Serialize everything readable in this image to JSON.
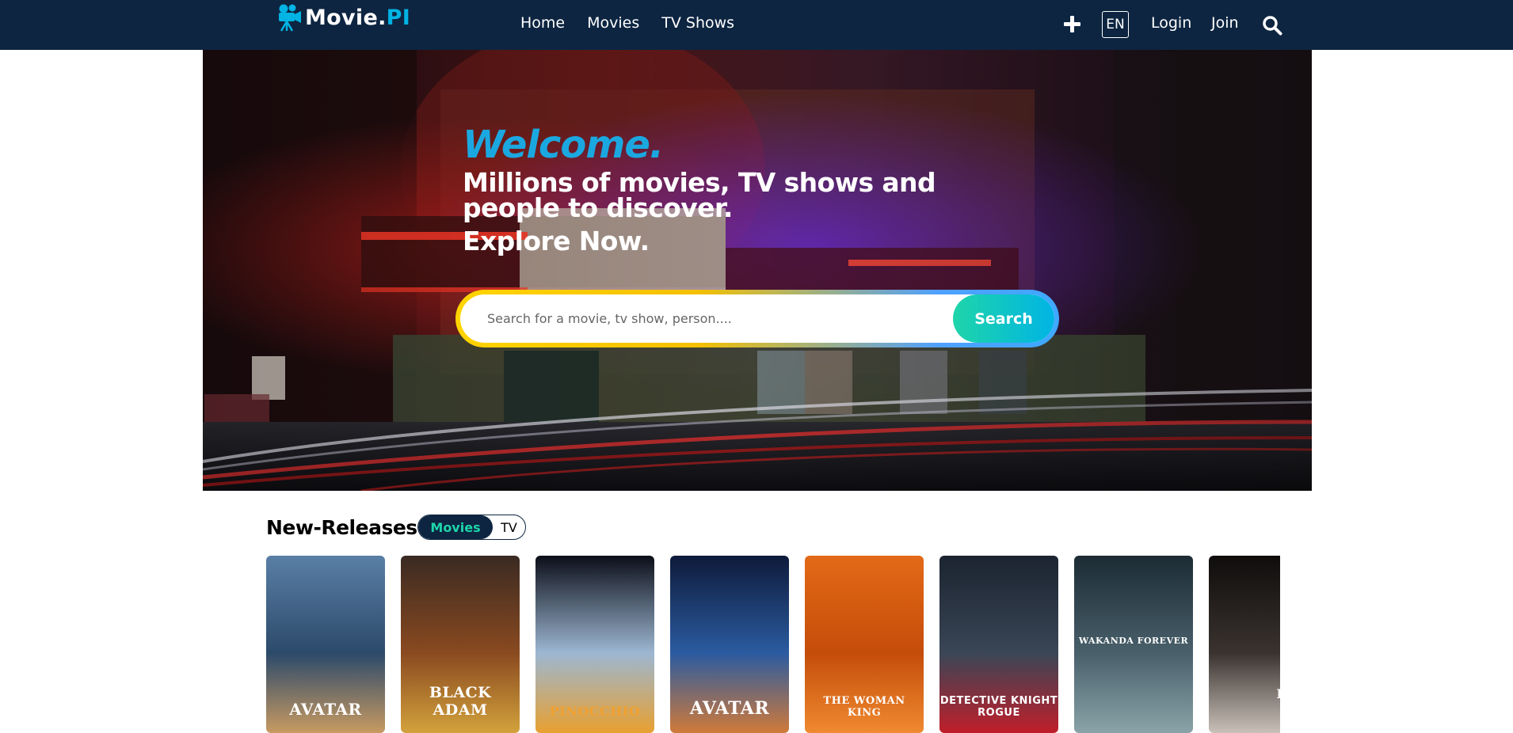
{
  "header": {
    "logo_main": "Movie.",
    "logo_accent": "PI",
    "nav": [
      "Home",
      "Movies",
      "TV Shows"
    ],
    "language": "EN",
    "login": "Login",
    "join": "Join"
  },
  "hero": {
    "welcome": "Welcome.",
    "tagline": "Millions of movies, TV shows and people to discover.",
    "explore": "Explore Now.",
    "search_placeholder": "Search for a movie, tv show, person....",
    "search_button": "Search"
  },
  "new_releases": {
    "title": "New-Releases",
    "toggle": {
      "active": "Movies",
      "inactive": "TV"
    },
    "posters": [
      {
        "title": "AVATAR",
        "colors": [
          "#5a7fa6",
          "#2c4a6a",
          "#c89a62"
        ]
      },
      {
        "title": "BLACK ADAM",
        "colors": [
          "#3a2a22",
          "#8a4a20",
          "#d3a23c"
        ]
      },
      {
        "title": "PINOCCHIO",
        "colors": [
          "#0b0e18",
          "#9db7d2",
          "#e8a030"
        ]
      },
      {
        "title": "AVATAR",
        "colors": [
          "#0e1a3a",
          "#2b5ba0",
          "#d07a3a"
        ]
      },
      {
        "title": "THE WOMAN KING",
        "colors": [
          "#e36a17",
          "#c44d0a",
          "#f08a30"
        ]
      },
      {
        "title": "DETECTIVE KNIGHT ROGUE",
        "colors": [
          "#1b2430",
          "#3a4656",
          "#c01e2a"
        ]
      },
      {
        "title": "WAKANDA FOREVER",
        "colors": [
          "#1c2b34",
          "#49606b",
          "#8aa3a8"
        ]
      },
      {
        "title": "PR DR",
        "colors": [
          "#0f0d0c",
          "#3a3330",
          "#c9c0b8"
        ]
      }
    ]
  }
}
